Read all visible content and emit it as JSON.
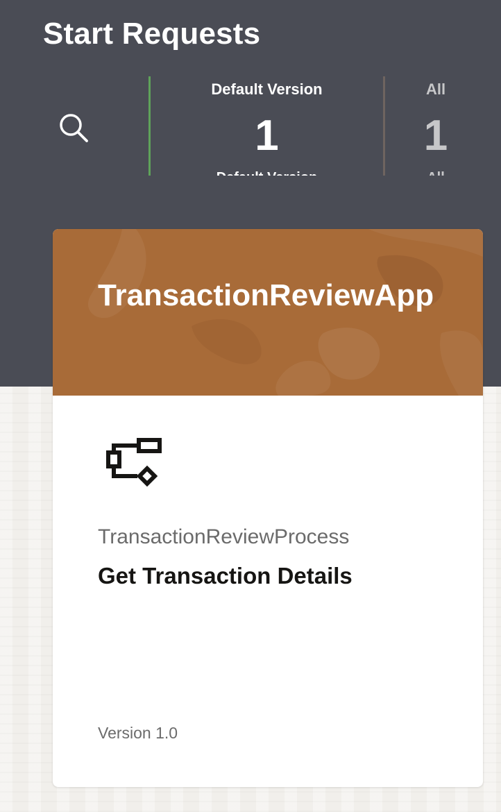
{
  "page": {
    "title": "Start Requests"
  },
  "icons": {
    "search": "search-icon",
    "process": "process-flow-icon"
  },
  "filters": [
    {
      "label": "Default Version",
      "count": "1",
      "sub_label": "Default Version",
      "accent_color": "#5fa35a"
    },
    {
      "label": "All",
      "count": "1",
      "sub_label": "All",
      "accent_color": "#6e6460"
    }
  ],
  "card": {
    "app_name": "TransactionReviewApp",
    "process_name": "TransactionReviewProcess",
    "request_name": "Get Transaction Details",
    "version": "Version 1.0",
    "banner_color": "#a86b38"
  },
  "colors": {
    "header_background": "#4a4c55",
    "page_background": "#f1efeb"
  }
}
